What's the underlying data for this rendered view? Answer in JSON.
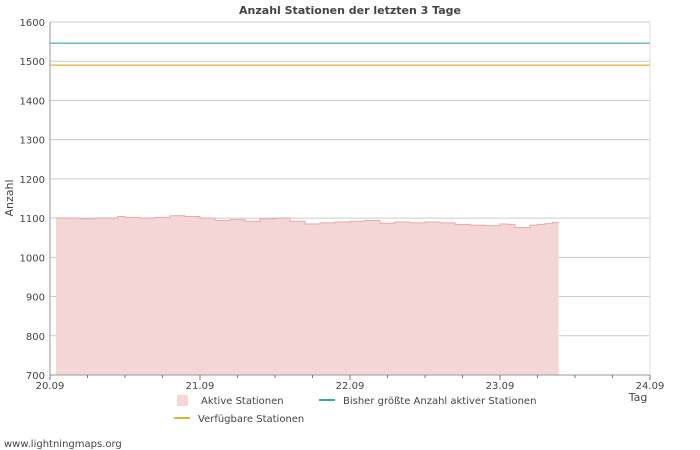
{
  "chart_data": {
    "type": "area",
    "title": "Anzahl Stationen der letzten 3 Tage",
    "ylabel": "Anzahl",
    "xlabel": "Tag",
    "ylim": [
      700,
      1600
    ],
    "xlim": [
      0,
      4
    ],
    "y_ticks": [
      700,
      800,
      900,
      1000,
      1100,
      1200,
      1300,
      1400,
      1500,
      1600
    ],
    "x_tick_labels": [
      "20.09",
      "21.09",
      "22.09",
      "23.09",
      "24.09"
    ],
    "grid": true,
    "legend_position": "bottom",
    "colors": {
      "area_fill": "#f5d6d7",
      "area_line": "#e7a9ab",
      "max_line": "#3aa6b3",
      "available_line": "#e0b23a",
      "grid": "#cccccc"
    },
    "series": [
      {
        "name": "Aktive Stationen",
        "kind": "area",
        "x": [
          0.04,
          0.2,
          0.3,
          0.45,
          0.5,
          0.6,
          0.7,
          0.8,
          0.9,
          1.0,
          1.1,
          1.2,
          1.3,
          1.4,
          1.5,
          1.6,
          1.7,
          1.8,
          1.9,
          2.0,
          2.1,
          2.2,
          2.3,
          2.4,
          2.5,
          2.6,
          2.7,
          2.8,
          2.9,
          3.0,
          3.05,
          3.1,
          3.2,
          3.25,
          3.3,
          3.35
        ],
        "values": [
          1100,
          1098,
          1100,
          1104,
          1102,
          1100,
          1102,
          1106,
          1104,
          1100,
          1094,
          1096,
          1092,
          1098,
          1100,
          1092,
          1085,
          1088,
          1090,
          1092,
          1094,
          1087,
          1090,
          1088,
          1090,
          1088,
          1084,
          1082,
          1081,
          1085,
          1084,
          1076,
          1082,
          1084,
          1086,
          1089
        ]
      },
      {
        "name": "Bisher größte Anzahl aktiver Stationen",
        "kind": "line",
        "value": 1546
      },
      {
        "name": "Verfügbare Stationen",
        "kind": "line",
        "value": 1490
      }
    ],
    "footer": "www.lightningmaps.org"
  }
}
